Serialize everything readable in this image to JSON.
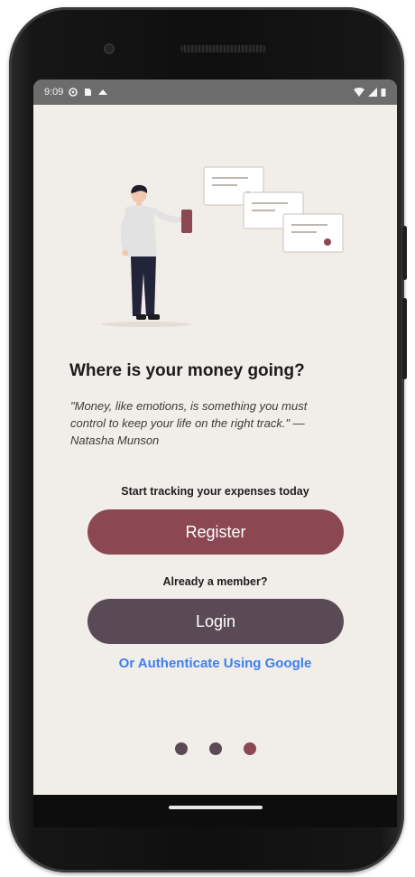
{
  "status_bar": {
    "time": "9:09",
    "icons_left": [
      "settings-icon",
      "sim-icon",
      "cloud-icon"
    ],
    "icons_right": [
      "wifi-icon",
      "signal-icon",
      "battery-icon"
    ]
  },
  "onboarding": {
    "heading": "Where is your money going?",
    "quote": "\"Money, like emotions, is something you must control to keep your life on the right track.\" — Natasha Munson",
    "register_prompt": "Start tracking your expenses today",
    "register_label": "Register",
    "login_prompt": "Already a member?",
    "login_label": "Login",
    "google_link": "Or Authenticate Using Google"
  },
  "pager": {
    "total": 3,
    "active_index": 2
  },
  "colors": {
    "screen_bg": "#f1ede8",
    "primary": "#8c4852",
    "secondary": "#5a4a55",
    "link": "#3d7ff0",
    "status_bar": "#6c6c6c"
  }
}
